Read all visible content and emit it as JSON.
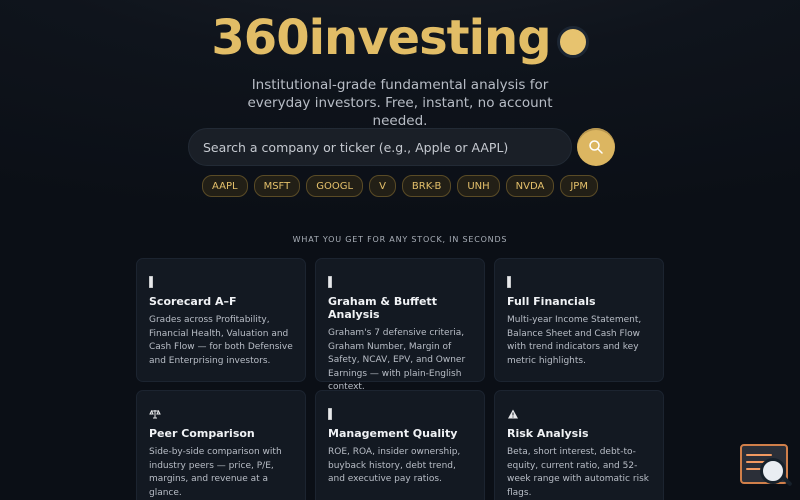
{
  "brand": {
    "title": "360investing"
  },
  "hero": {
    "subtitle": "Institutional-grade fundamental analysis for everyday investors. Free, instant, no account needed."
  },
  "search": {
    "placeholder": "Search a company or ticker (e.g., Apple or AAPL)"
  },
  "tickers": [
    "AAPL",
    "MSFT",
    "GOOGL",
    "V",
    "BRK-B",
    "UNH",
    "NVDA",
    "JPM"
  ],
  "features": {
    "section_title": "WHAT YOU GET FOR ANY STOCK, IN SECONDS",
    "cards": [
      {
        "icon": "bar-icon",
        "title": "Scorecard A–F",
        "desc": "Grades across Profitability, Financial Health, Valuation and Cash Flow — for both Defensive and Enterprising investors."
      },
      {
        "icon": "bar-icon",
        "title": "Graham & Buffett Analysis",
        "desc": "Graham's 7 defensive criteria, Graham Number, Margin of Safety, NCAV, EPV, and Owner Earnings — with plain-English context."
      },
      {
        "icon": "bar-icon",
        "title": "Full Financials",
        "desc": "Multi-year Income Statement, Balance Sheet and Cash Flow with trend indicators and key metric highlights."
      },
      {
        "icon": "scales-icon",
        "title": "Peer Comparison",
        "desc": "Side-by-side comparison with industry peers — price, P/E, margins, and revenue at a glance."
      },
      {
        "icon": "bar-icon",
        "title": "Management Quality",
        "desc": "ROE, ROA, insider ownership, buyback history, debt trend, and executive pay ratios."
      },
      {
        "icon": "warning-icon",
        "title": "Risk Analysis",
        "desc": "Beta, short interest, debt-to-equity, current ratio, and 52-week range with automatic risk flags."
      }
    ]
  },
  "colors": {
    "accent": "#e2bd66",
    "background": "#0b0f16",
    "card_bg": "#131922"
  }
}
